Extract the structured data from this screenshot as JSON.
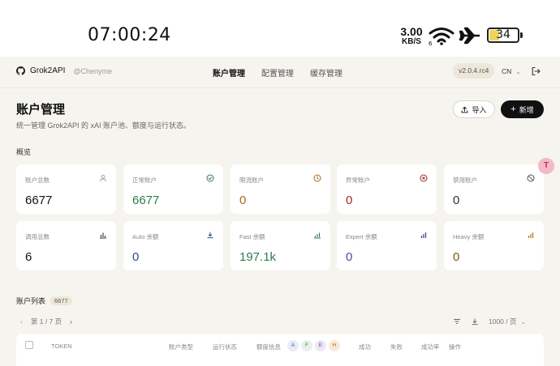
{
  "statusbar": {
    "time": "07:00:24",
    "speed_value": "3.00",
    "speed_unit": "KB/S",
    "battery": "34"
  },
  "nav": {
    "brand": "Grok2API",
    "handle": "@Chenyme",
    "tabs": [
      "账户管理",
      "配置管理",
      "缓存管理"
    ],
    "active_tab": "账户管理",
    "version": "v2.0.4.rc4",
    "lang": "CN"
  },
  "page": {
    "title": "账户管理",
    "subtitle": "统一管理 Grok2API 的 xAI 账户池、额度与运行状态。",
    "import_label": "导入",
    "new_label": "新增",
    "overview_label": "概览"
  },
  "stats": [
    {
      "label": "账户总数",
      "value": "6677",
      "color": "#111111",
      "icon": "user-icon"
    },
    {
      "label": "正常账户",
      "value": "6677",
      "color": "#2f7d4f",
      "icon": "check-circle-icon"
    },
    {
      "label": "限流账户",
      "value": "0",
      "color": "#b5651d",
      "icon": "clock-icon"
    },
    {
      "label": "异常账户",
      "value": "0",
      "color": "#9a2b2b",
      "icon": "error-circle-icon"
    },
    {
      "label": "禁用账户",
      "value": "0",
      "color": "#333333",
      "icon": "ban-icon"
    },
    {
      "label": "调用总数",
      "value": "6",
      "color": "#111111",
      "icon": "bar-chart-icon"
    },
    {
      "label": "Auto 余额",
      "value": "0",
      "color": "#2c4f86",
      "icon": "download-icon"
    },
    {
      "label": "Fast 余额",
      "value": "197.1k",
      "color": "#2f7d4f",
      "icon": "bar-chart-icon"
    },
    {
      "label": "Expert 余额",
      "value": "0",
      "color": "#5b3f9e",
      "icon": "bar-chart-icon"
    },
    {
      "label": "Heavy 余额",
      "value": "0",
      "color": "#7a5a1f",
      "icon": "bar-chart-icon"
    }
  ],
  "list": {
    "title": "账户列表",
    "count": "6677",
    "page_info": "第 1 / 7 页",
    "page_size": "1000 / 页",
    "columns": [
      "TOKEN",
      "账户类型",
      "运行状态",
      "额度信息",
      "成功",
      "失败",
      "成功率",
      "操作"
    ],
    "quota_tags": [
      "A",
      "F",
      "E",
      "H"
    ]
  },
  "float_badge": "T",
  "colors": {
    "background": "#f6f4ef",
    "accent": "#111111"
  }
}
